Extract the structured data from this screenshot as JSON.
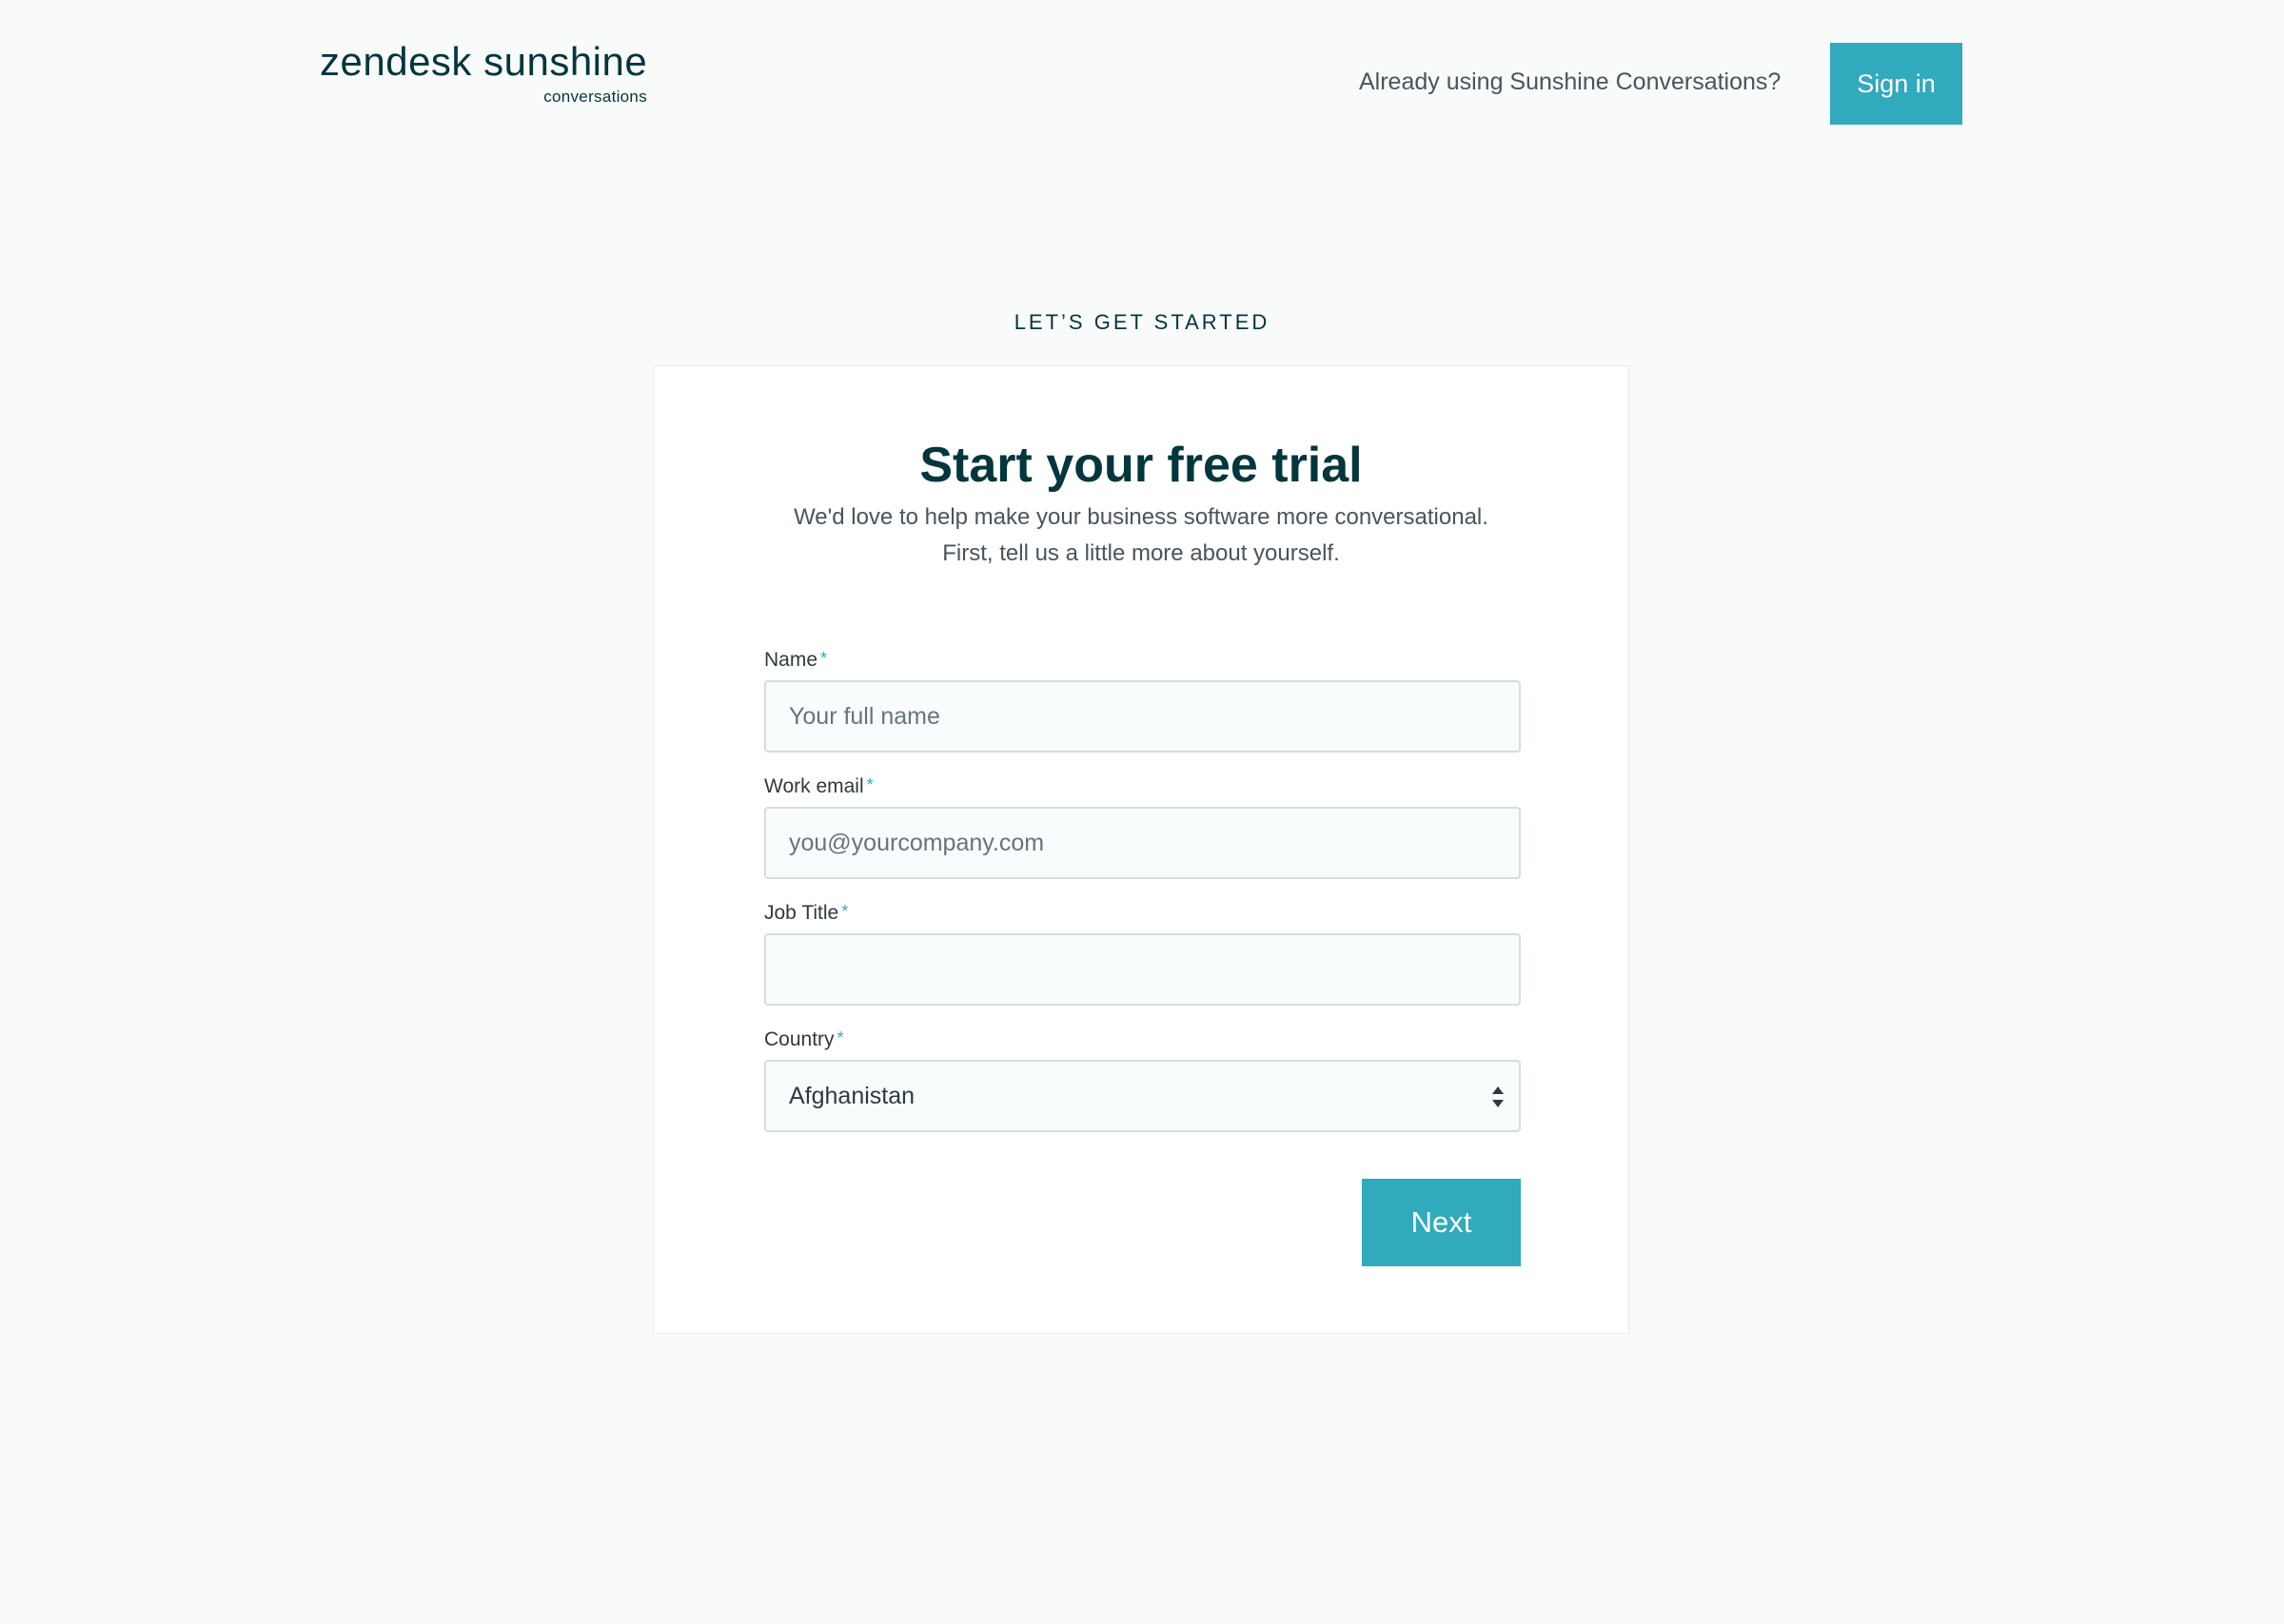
{
  "header": {
    "logo_main": "zendesk sunshine",
    "logo_sub": "conversations",
    "signin_prompt": "Already using Sunshine Conversations?",
    "signin_label": "Sign in"
  },
  "eyebrow": "LET’S GET STARTED",
  "card": {
    "title": "Start your free trial",
    "subtitle_line1": "We'd love to help make your business software more conversational.",
    "subtitle_line2": "First, tell us a little more about yourself."
  },
  "form": {
    "required_marker": "*",
    "name": {
      "label": "Name",
      "placeholder": "Your full name",
      "value": ""
    },
    "email": {
      "label": "Work email",
      "placeholder": "you@yourcompany.com",
      "value": ""
    },
    "job_title": {
      "label": "Job Title",
      "placeholder": "",
      "value": ""
    },
    "country": {
      "label": "Country",
      "selected": "Afghanistan"
    },
    "next_label": "Next"
  },
  "colors": {
    "accent": "#30aabc",
    "brand_dark": "#03363d",
    "page_bg": "#f9fafa"
  },
  "icons": {
    "select_arrows": "up-down-chevron-icon"
  }
}
